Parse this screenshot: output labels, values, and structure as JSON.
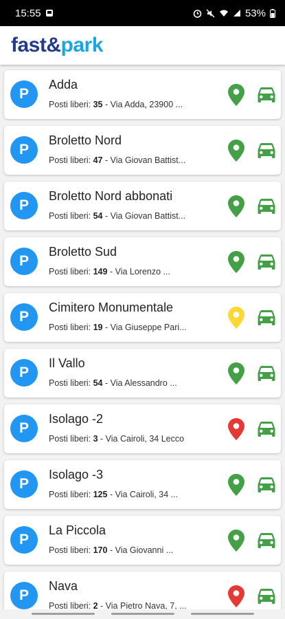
{
  "status_bar": {
    "time": "15:55",
    "battery": "53%",
    "icons": [
      "notification-icon",
      "alarm-icon",
      "mute-icon",
      "wifi-icon",
      "signal-icon",
      "battery-icon"
    ]
  },
  "app": {
    "logo_part1": "fast",
    "logo_amp": "&",
    "logo_part2": "park"
  },
  "colors": {
    "brand_dark": "#233a8f",
    "brand_light": "#1aa7e0",
    "badge_blue": "#2196f3",
    "status_green": "#43a047",
    "status_yellow": "#fdd835",
    "status_red": "#e53935",
    "car_green": "#43a047"
  },
  "parkings": [
    {
      "name": "Adda",
      "free_label": "Posti liberi: ",
      "free_count": "35",
      "address": " - Via Adda, 23900 ...",
      "status": "green"
    },
    {
      "name": "Broletto Nord",
      "free_label": "Posti liberi: ",
      "free_count": "47",
      "address": " - Via Giovan Battist...",
      "status": "green"
    },
    {
      "name": "Broletto Nord abbonati",
      "free_label": "Posti liberi: ",
      "free_count": "54",
      "address": " - Via Giovan Battist...",
      "status": "green"
    },
    {
      "name": "Broletto Sud",
      "free_label": "Posti liberi: ",
      "free_count": "149",
      "address": " - Via Lorenzo ...",
      "status": "green"
    },
    {
      "name": "Cimitero Monumentale",
      "free_label": "Posti liberi: ",
      "free_count": "19",
      "address": " - Via Giuseppe Pari...",
      "status": "yellow"
    },
    {
      "name": "Il Vallo",
      "free_label": "Posti liberi: ",
      "free_count": "54",
      "address": " - Via Alessandro ...",
      "status": "green"
    },
    {
      "name": "Isolago -2",
      "free_label": "Posti liberi: ",
      "free_count": "3",
      "address": " - Via Cairoli, 34 Lecco",
      "status": "red"
    },
    {
      "name": "Isolago -3",
      "free_label": "Posti liberi: ",
      "free_count": "125",
      "address": " - Via Cairoli, 34 ...",
      "status": "green"
    },
    {
      "name": "La Piccola",
      "free_label": "Posti liberi: ",
      "free_count": "170",
      "address": " - Via Giovanni ...",
      "status": "green"
    },
    {
      "name": "Nava",
      "free_label": "Posti liberi: ",
      "free_count": "2",
      "address": " - Via Pietro Nava, 7, ...",
      "status": "red"
    }
  ],
  "badge_letter": "P"
}
